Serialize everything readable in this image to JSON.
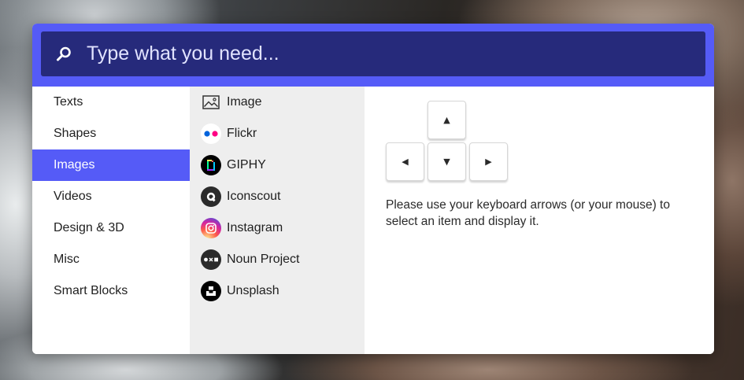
{
  "search": {
    "placeholder": "Type what you need..."
  },
  "categories": [
    {
      "label": "Texts"
    },
    {
      "label": "Shapes"
    },
    {
      "label": "Images"
    },
    {
      "label": "Videos"
    },
    {
      "label": "Design & 3D"
    },
    {
      "label": "Misc"
    },
    {
      "label": "Smart Blocks"
    }
  ],
  "active_category": "Images",
  "sources": [
    {
      "label": "Image",
      "icon": "image-icon"
    },
    {
      "label": "Flickr",
      "icon": "flickr-icon"
    },
    {
      "label": "GIPHY",
      "icon": "giphy-icon"
    },
    {
      "label": "Iconscout",
      "icon": "iconscout-icon"
    },
    {
      "label": "Instagram",
      "icon": "instagram-icon"
    },
    {
      "label": "Noun Project",
      "icon": "noun-project-icon"
    },
    {
      "label": "Unsplash",
      "icon": "unsplash-icon"
    }
  ],
  "keys": {
    "up": "▲",
    "left": "◀",
    "down": "▼",
    "right": "▶"
  },
  "hint": "Please use your keyboard arrows (or your mouse) to select an item and display it.",
  "colors": {
    "accent": "#555bf7",
    "search_bg": "#262a7b",
    "sources_bg": "#eeeeee"
  }
}
